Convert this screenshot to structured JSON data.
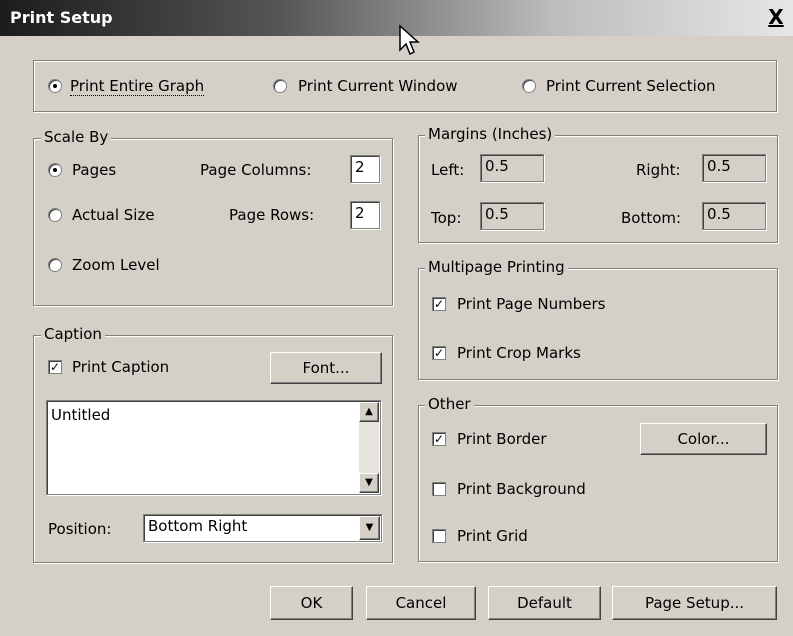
{
  "window": {
    "title": "Print Setup",
    "close": "X"
  },
  "print_mode": {
    "options": [
      {
        "label": "Print Entire Graph",
        "selected": true
      },
      {
        "label": "Print Current Window",
        "selected": false
      },
      {
        "label": "Print Current Selection",
        "selected": false
      }
    ]
  },
  "scale_by": {
    "legend": "Scale By",
    "pages": {
      "label": "Pages",
      "selected": true
    },
    "actual_size": {
      "label": "Actual Size",
      "selected": false
    },
    "zoom_level": {
      "label": "Zoom Level",
      "selected": false
    },
    "page_columns": {
      "label": "Page Columns:",
      "value": "2"
    },
    "page_rows": {
      "label": "Page Rows:",
      "value": "2"
    }
  },
  "margins": {
    "legend": "Margins (Inches)",
    "left": {
      "label": "Left:",
      "value": "0.5"
    },
    "right": {
      "label": "Right:",
      "value": "0.5"
    },
    "top": {
      "label": "Top:",
      "value": "0.5"
    },
    "bottom": {
      "label": "Bottom:",
      "value": "0.5"
    }
  },
  "multipage": {
    "legend": "Multipage Printing",
    "page_numbers": {
      "label": "Print Page Numbers",
      "checked": true
    },
    "crop_marks": {
      "label": "Print Crop Marks",
      "checked": true
    }
  },
  "caption": {
    "legend": "Caption",
    "print_caption": {
      "label": "Print Caption",
      "checked": true
    },
    "font_button": "Font...",
    "text": "Untitled",
    "position_label": "Position:",
    "position_value": "Bottom Right"
  },
  "other": {
    "legend": "Other",
    "border": {
      "label": "Print Border",
      "checked": true
    },
    "background": {
      "label": "Print Background",
      "checked": false
    },
    "grid": {
      "label": "Print Grid",
      "checked": false
    },
    "color_button": "Color..."
  },
  "buttons": {
    "ok": "OK",
    "cancel": "Cancel",
    "default": "Default",
    "page_setup": "Page Setup..."
  },
  "check_mark": "✓"
}
